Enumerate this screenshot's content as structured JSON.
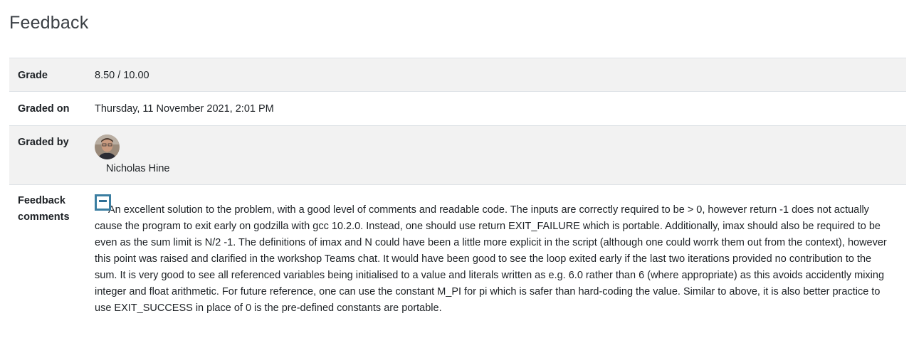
{
  "page": {
    "title": "Feedback"
  },
  "feedback": {
    "grade_label": "Grade",
    "grade_value": "8.50 / 10.00",
    "graded_on_label": "Graded on",
    "graded_on_value": "Thursday, 11 November 2021, 2:01 PM",
    "graded_by_label": "Graded by",
    "grader_name": "Nicholas Hine",
    "comments_label_line1": "Feedback",
    "comments_label_line2": "comments",
    "comments_text": "An excellent solution to the problem, with a good level of comments and readable code. The inputs are correctly required to be > 0, however return -1 does not actually cause the program to exit early on godzilla with gcc 10.2.0. Instead, one should use return EXIT_FAILURE which is portable. Additionally, imax should also be required to be even as the sum limit is N/2 -1. The definitions of imax and N could have been a little more explicit in the script (although one could worrk them out from the context), however this point was raised and clarified in the workshop Teams chat. It would have been good to see the loop exited early if the last two iterations provided no contribution to the sum. It is very good to see all referenced variables being initialised to a value and literals written as e.g. 6.0 rather than 6 (where appropriate) as this avoids accidently mixing integer and float arithmetic. For future reference, one can use the constant M_PI for pi which is safer than hard-coding the value. Similar to above, it is also better practice to use EXIT_SUCCESS in place of 0 is the pre-defined constants are portable."
  },
  "icons": {
    "avatar": "user-avatar-photo",
    "collapse": "collapse-minus-icon"
  },
  "colors": {
    "row_shade": "#f2f2f2",
    "border": "#dee2e6",
    "toggle_accent": "#3b7ea1"
  }
}
